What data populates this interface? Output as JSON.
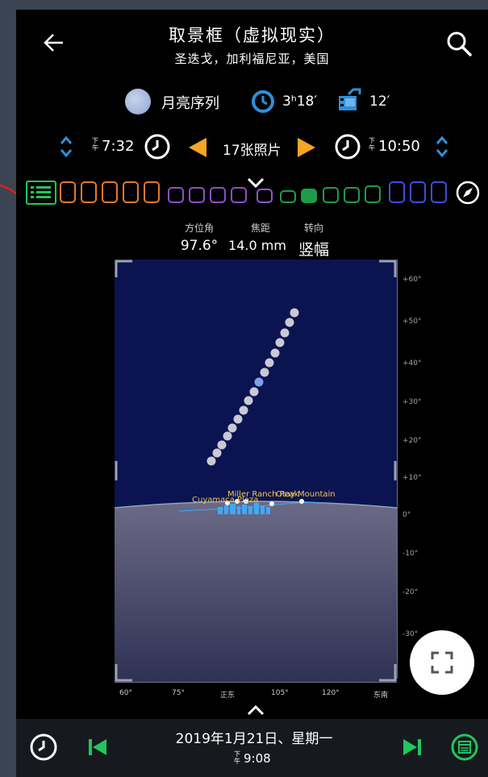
{
  "header": {
    "title": "取景框（虚拟现实）",
    "location": "圣迭戈，加利福尼亚，美国"
  },
  "sequence": {
    "label": "月亮序列",
    "duration": "3ʰ18′",
    "interval": "12′"
  },
  "time_range": {
    "start_ampm": "下午",
    "start_time": "7:32",
    "photo_count": "17张照片",
    "end_ampm": "下午",
    "end_time": "10:50"
  },
  "params": {
    "azimuth_label": "方位角",
    "focal_label": "焦距",
    "orientation_label": "转向",
    "azimuth_value": "97.6°",
    "focal_value": "14.0 mm",
    "orientation_value": "竖幅"
  },
  "view": {
    "landmarks": [
      "Miller Ranch Peak",
      "Otay Mountain",
      "Cuyamaca Plaza"
    ],
    "altitude_ticks": [
      "+60°",
      "+50°",
      "+40°",
      "+30°",
      "+20°",
      "+10°",
      "0°",
      "-10°",
      "-20°",
      "-30°"
    ],
    "azimuth_ticks": [
      "60°",
      "75°",
      "正东",
      "105°",
      "120°",
      "东南"
    ]
  },
  "footer": {
    "date": "2019年1月21日、星期一",
    "ampm": "下午",
    "time": "9:08"
  },
  "colors": {
    "accent_green": "#22c55e",
    "accent_blue": "#2f8fd8",
    "accent_orange": "#f5a623",
    "sky": "#0b1450",
    "ground": "#4d4d68"
  }
}
